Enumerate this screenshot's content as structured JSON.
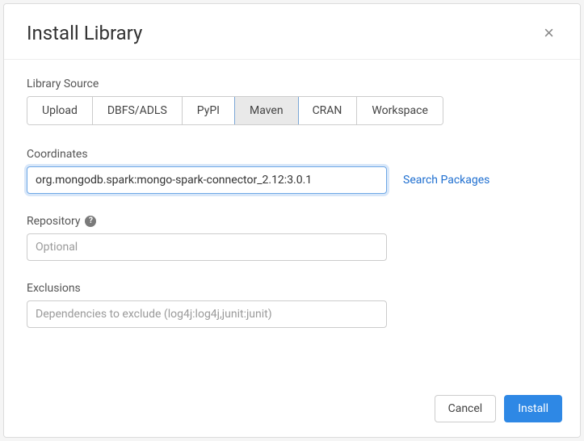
{
  "header": {
    "title": "Install Library",
    "close_glyph": "×"
  },
  "library_source": {
    "label": "Library Source",
    "options": [
      "Upload",
      "DBFS/ADLS",
      "PyPI",
      "Maven",
      "CRAN",
      "Workspace"
    ],
    "active_index": 3
  },
  "coordinates": {
    "label": "Coordinates",
    "value": "org.mongodb.spark:mongo-spark-connector_2.12:3.0.1",
    "search_link": "Search Packages"
  },
  "repository": {
    "label": "Repository",
    "placeholder": "Optional",
    "help_glyph": "?"
  },
  "exclusions": {
    "label": "Exclusions",
    "placeholder": "Dependencies to exclude (log4j:log4j,junit:junit)"
  },
  "footer": {
    "cancel": "Cancel",
    "install": "Install"
  }
}
